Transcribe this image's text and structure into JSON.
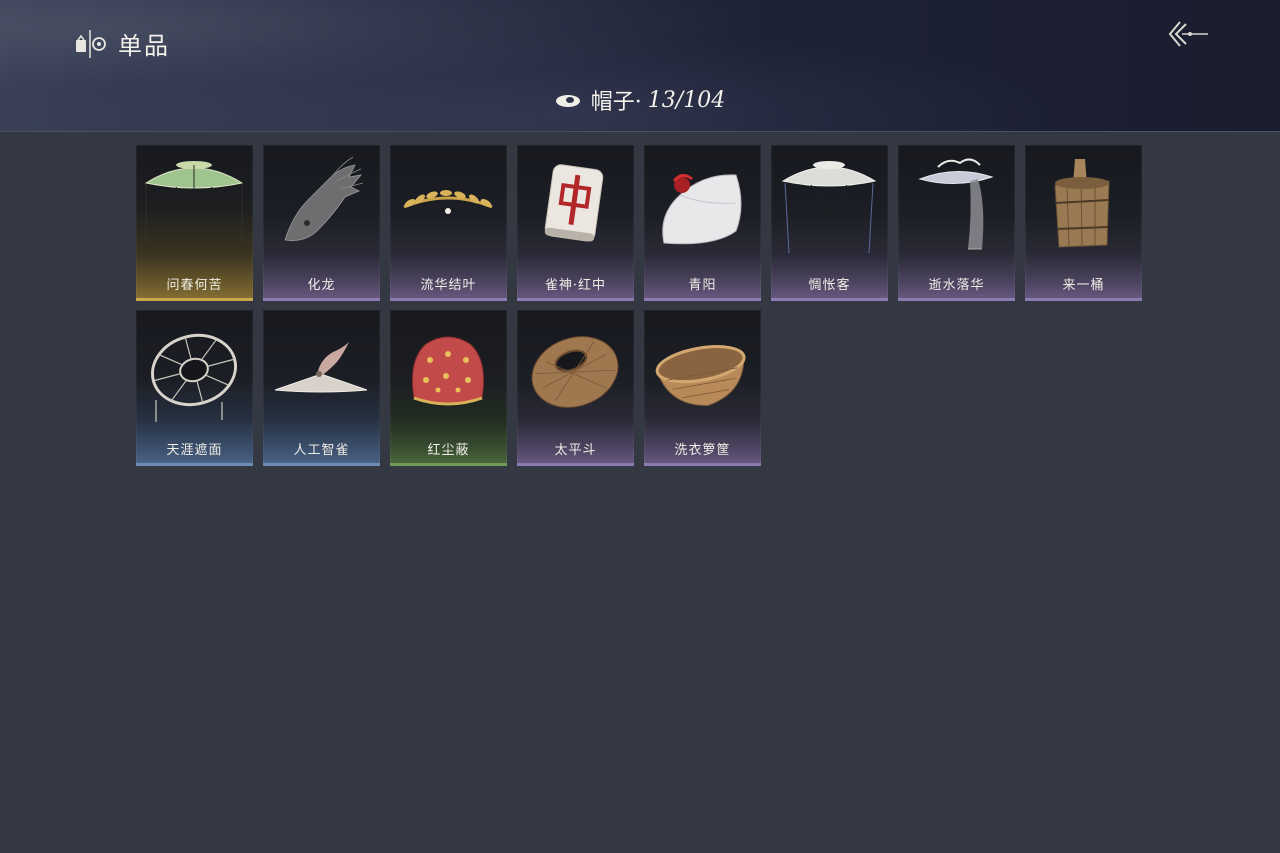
{
  "header": {
    "title": "单品",
    "category_label": "帽子·",
    "count": "13/104"
  },
  "items": [
    {
      "name": "问春何苦",
      "icon": "green-bamboo-hat-icon",
      "rarity": "gold"
    },
    {
      "name": "化龙",
      "icon": "dragon-head-icon",
      "rarity": "purple"
    },
    {
      "name": "流华结叶",
      "icon": "gold-leaf-crown-icon",
      "rarity": "purple"
    },
    {
      "name": "雀神·红中",
      "icon": "mahjong-tile-icon",
      "rarity": "purple"
    },
    {
      "name": "青阳",
      "icon": "white-feather-hat-icon",
      "rarity": "purple"
    },
    {
      "name": "惆怅客",
      "icon": "white-bamboo-hat-icon",
      "rarity": "purple"
    },
    {
      "name": "逝水落华",
      "icon": "veiled-hat-icon",
      "rarity": "purple"
    },
    {
      "name": "来一桶",
      "icon": "wooden-bucket-icon",
      "rarity": "purple"
    },
    {
      "name": "天涯遮面",
      "icon": "wicker-frame-hat-icon",
      "rarity": "blue"
    },
    {
      "name": "人工智雀",
      "icon": "bird-hat-icon",
      "rarity": "blue"
    },
    {
      "name": "红尘蔽",
      "icon": "red-cloth-hood-icon",
      "rarity": "green"
    },
    {
      "name": "太平斗",
      "icon": "woven-basket-hat-icon",
      "rarity": "purple"
    },
    {
      "name": "洗衣箩筐",
      "icon": "laundry-basket-icon",
      "rarity": "purple"
    }
  ]
}
